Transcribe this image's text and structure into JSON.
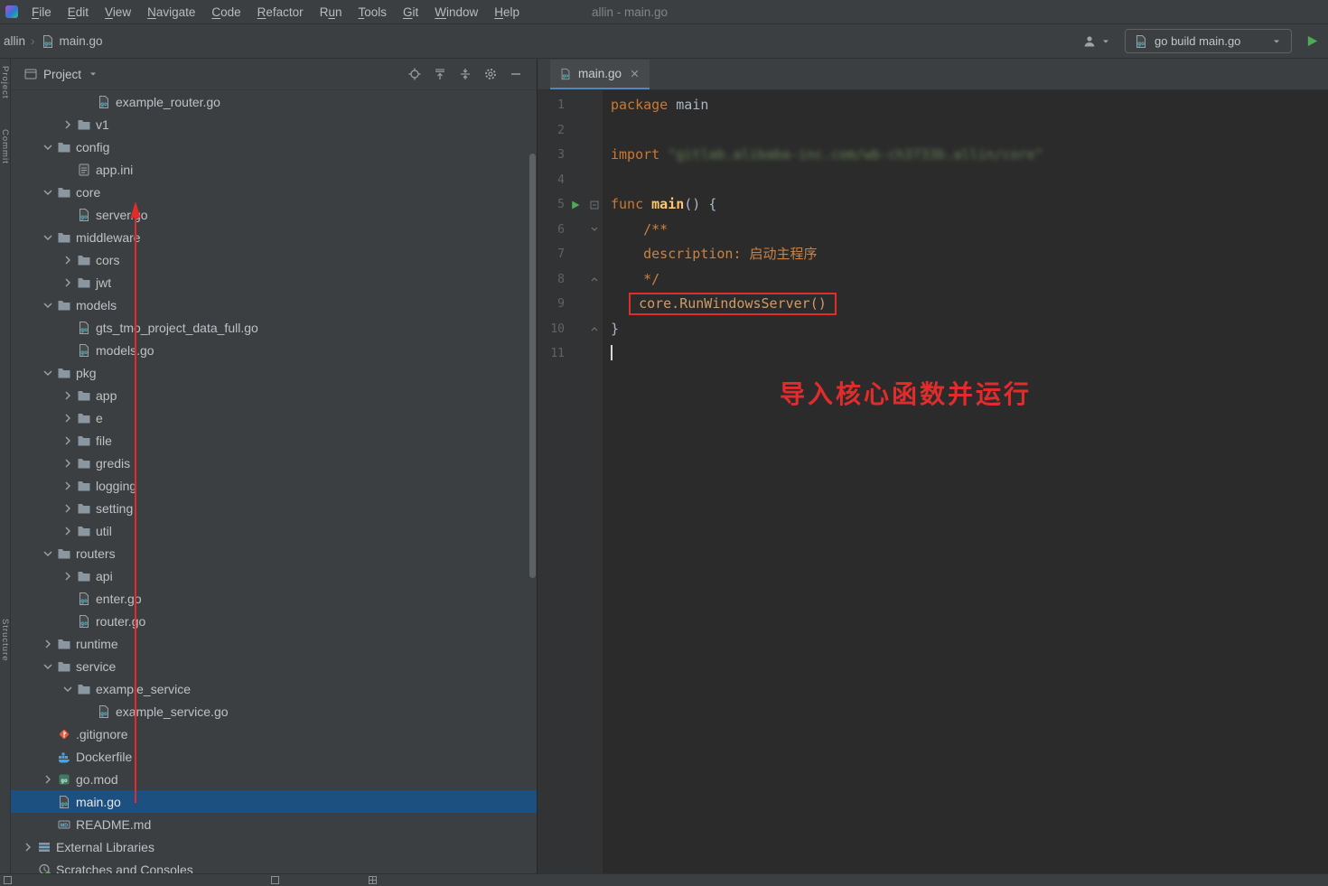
{
  "window": {
    "title": "allin - main.go"
  },
  "menu": {
    "items": [
      {
        "label": "File",
        "mnemonic": 0
      },
      {
        "label": "Edit",
        "mnemonic": 0
      },
      {
        "label": "View",
        "mnemonic": 0
      },
      {
        "label": "Navigate",
        "mnemonic": 0
      },
      {
        "label": "Code",
        "mnemonic": 0
      },
      {
        "label": "Refactor",
        "mnemonic": 0
      },
      {
        "label": "Run",
        "mnemonic": 1
      },
      {
        "label": "Tools",
        "mnemonic": 0
      },
      {
        "label": "Git",
        "mnemonic": 0
      },
      {
        "label": "Window",
        "mnemonic": 0
      },
      {
        "label": "Help",
        "mnemonic": 0
      }
    ]
  },
  "toolbar": {
    "project": "allin",
    "separator": "›",
    "file": "main.go",
    "run_config": "go build main.go"
  },
  "activity_bar": {
    "items": [
      "Project",
      "Commit",
      "Structure"
    ]
  },
  "project_panel": {
    "title": "Project",
    "tree": [
      {
        "label": "example_router.go",
        "indent": 3,
        "icon": "go"
      },
      {
        "label": "v1",
        "indent": 2,
        "state": "collapsed",
        "icon": "folder"
      },
      {
        "label": "config",
        "indent": 1,
        "state": "expanded",
        "icon": "folder"
      },
      {
        "label": "app.ini",
        "indent": 2,
        "icon": "ini"
      },
      {
        "label": "core",
        "indent": 1,
        "state": "expanded",
        "icon": "folder"
      },
      {
        "label": "server.go",
        "indent": 2,
        "icon": "go"
      },
      {
        "label": "middleware",
        "indent": 1,
        "state": "expanded",
        "icon": "folder"
      },
      {
        "label": "cors",
        "indent": 2,
        "state": "collapsed",
        "icon": "folder"
      },
      {
        "label": "jwt",
        "indent": 2,
        "state": "collapsed",
        "icon": "folder"
      },
      {
        "label": "models",
        "indent": 1,
        "state": "expanded",
        "icon": "folder"
      },
      {
        "label": "gts_tmo_project_data_full.go",
        "indent": 2,
        "icon": "go"
      },
      {
        "label": "models.go",
        "indent": 2,
        "icon": "go"
      },
      {
        "label": "pkg",
        "indent": 1,
        "state": "expanded",
        "icon": "folder"
      },
      {
        "label": "app",
        "indent": 2,
        "state": "collapsed",
        "icon": "folder"
      },
      {
        "label": "e",
        "indent": 2,
        "state": "collapsed",
        "icon": "folder"
      },
      {
        "label": "file",
        "indent": 2,
        "state": "collapsed",
        "icon": "folder"
      },
      {
        "label": "gredis",
        "indent": 2,
        "state": "collapsed",
        "icon": "folder"
      },
      {
        "label": "logging",
        "indent": 2,
        "state": "collapsed",
        "icon": "folder"
      },
      {
        "label": "setting",
        "indent": 2,
        "state": "collapsed",
        "icon": "folder"
      },
      {
        "label": "util",
        "indent": 2,
        "state": "collapsed",
        "icon": "folder"
      },
      {
        "label": "routers",
        "indent": 1,
        "state": "expanded",
        "icon": "folder"
      },
      {
        "label": "api",
        "indent": 2,
        "state": "collapsed",
        "icon": "folder"
      },
      {
        "label": "enter.go",
        "indent": 2,
        "icon": "go"
      },
      {
        "label": "router.go",
        "indent": 2,
        "icon": "go"
      },
      {
        "label": "runtime",
        "indent": 1,
        "state": "collapsed",
        "icon": "folder"
      },
      {
        "label": "service",
        "indent": 1,
        "state": "expanded",
        "icon": "folder"
      },
      {
        "label": "example_service",
        "indent": 2,
        "state": "expanded",
        "icon": "folder"
      },
      {
        "label": "example_service.go",
        "indent": 3,
        "icon": "go"
      },
      {
        "label": ".gitignore",
        "indent": 1,
        "icon": "git"
      },
      {
        "label": "Dockerfile",
        "indent": 1,
        "icon": "docker"
      },
      {
        "label": "go.mod",
        "indent": 1,
        "state": "collapsed",
        "icon": "gomod"
      },
      {
        "label": "main.go",
        "indent": 1,
        "icon": "go",
        "selected": true
      },
      {
        "label": "README.md",
        "indent": 1,
        "icon": "md"
      },
      {
        "label": "External Libraries",
        "indent": 0,
        "state": "collapsed",
        "icon": "lib"
      },
      {
        "label": "Scratches and Consoles",
        "indent": 0,
        "icon": "scratch"
      }
    ]
  },
  "editor": {
    "tab": "main.go",
    "annotation": "导入核心函数并运行",
    "lines": [
      {
        "n": "1",
        "tokens": [
          {
            "t": "package",
            "c": "k"
          },
          {
            "t": " main",
            "c": "p"
          }
        ]
      },
      {
        "n": "2",
        "tokens": []
      },
      {
        "n": "3",
        "tokens": [
          {
            "t": "import ",
            "c": "k"
          },
          {
            "t": "\"gitlab.alibaba-inc.com/wb-ch3733b.allin/core\"",
            "c": "s"
          }
        ]
      },
      {
        "n": "4",
        "tokens": []
      },
      {
        "n": "5",
        "run": true,
        "fold": "m",
        "tokens": [
          {
            "t": "func ",
            "c": "k"
          },
          {
            "t": "main",
            "c": "f"
          },
          {
            "t": "() {",
            "c": "p"
          }
        ]
      },
      {
        "n": "6",
        "fold": "d",
        "tokens": [
          {
            "t": "    /**",
            "c": "c"
          }
        ]
      },
      {
        "n": "7",
        "tokens": [
          {
            "t": "    description: 启动主程序",
            "c": "c"
          }
        ]
      },
      {
        "n": "8",
        "fold": "u",
        "tokens": [
          {
            "t": "    */",
            "c": "c"
          }
        ]
      },
      {
        "n": "9",
        "tokens": [
          {
            "t": "  ",
            "c": "p"
          },
          {
            "t": "core.RunWindowsServer()",
            "c": "m",
            "box": true
          }
        ]
      },
      {
        "n": "10",
        "fold": "u",
        "tokens": [
          {
            "t": "}",
            "c": "p"
          }
        ]
      },
      {
        "n": "11",
        "cursor": true,
        "tokens": []
      }
    ]
  },
  "colors": {
    "accent_red": "#e22c2c",
    "selection_blue": "#1c5081",
    "keyword_orange": "#cc7832",
    "plain_text": "#a9b7c6",
    "comment_tan": "#cc8242",
    "string_green": "#6a8759",
    "func_yellow": "#ffc66d",
    "call_orange": "#d19a66",
    "run_green": "#4faa59"
  }
}
